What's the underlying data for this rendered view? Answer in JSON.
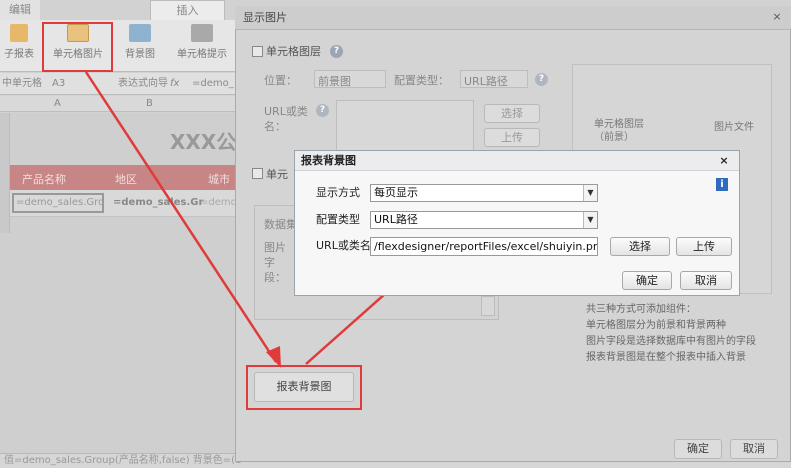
{
  "designer": {
    "tabs": [
      "编辑",
      "插入"
    ],
    "ribbon": [
      "子报表",
      "单元格图片",
      "背景图",
      "单元格提示"
    ],
    "cell_label": "中单元格",
    "cell_ref": "A3",
    "formula_label": "表达式向导",
    "fx": "fx",
    "formula_value": "=demo_",
    "columns": [
      "A",
      "B"
    ],
    "title_text": "XXX公",
    "headers": [
      "产品名称",
      "地区",
      "城市"
    ],
    "row_cells": [
      "=demo_sales.Gro",
      "=demo_sales.Gr",
      "=demo"
    ],
    "status_text": "值=demo_sales.Group(产品名称,false) 背景色=(1"
  },
  "main_dialog": {
    "title": "显示图片",
    "close": "×",
    "cell_image_layer": "单元格图层",
    "position_label": "位置：",
    "position_value": "前景图",
    "config_type_label": "配置类型：",
    "config_type_value": "URL路径",
    "url_label": "URL或类名：",
    "select": "选择",
    "upload": "上传",
    "cell_section": "单元",
    "dataset_label": "数据集",
    "image_field_label": "图片字段：",
    "preview_label_1": "单元格图层（前景）",
    "preview_label_2": "图片文件",
    "notes": [
      "共三种方式可添加组件：",
      "单元格图层分为前景和背景两种",
      "图片字段是选择数据库中有图片的字段",
      "报表背景图是在整个报表中插入背景"
    ],
    "report_bg_button": "报表背景图",
    "ok": "确定",
    "cancel": "取消"
  },
  "bg_dialog": {
    "title": "报表背景图",
    "close": "×",
    "help": "i",
    "display_mode_label": "显示方式",
    "display_mode_value": "每页显示",
    "config_type_label": "配置类型",
    "config_type_value": "URL路径",
    "url_label": "URL或类名",
    "url_value": "/flexdesigner/reportFiles/excel/shuiyin.png",
    "select": "选择",
    "upload": "上传",
    "ok": "确定",
    "cancel": "取消"
  },
  "colors": {
    "highlight": "#e03b3b",
    "header_row": "#c88585",
    "help_icon": "#2f6bbf"
  }
}
